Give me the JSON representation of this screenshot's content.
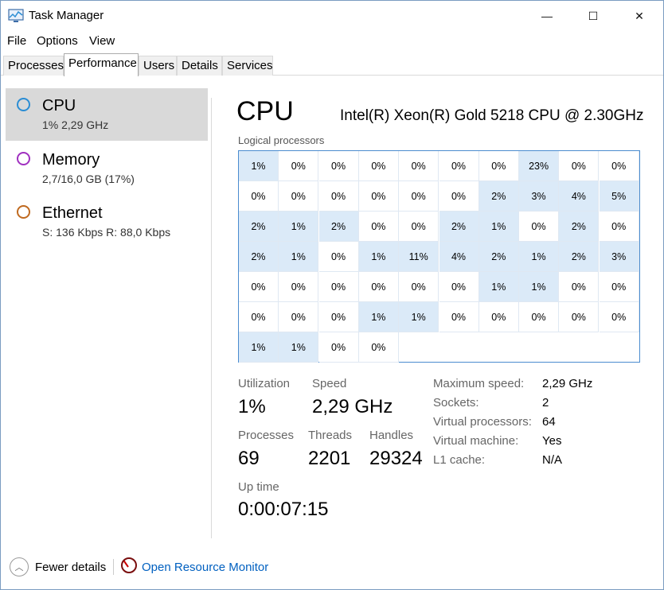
{
  "window": {
    "title": "Task Manager",
    "controls": {
      "minimize": "—",
      "maximize": "☐",
      "close": "✕"
    }
  },
  "menu": [
    "File",
    "Options",
    "View"
  ],
  "tabs": [
    "Processes",
    "Performance",
    "Users",
    "Details",
    "Services"
  ],
  "active_tab": "Performance",
  "sidebar": [
    {
      "name": "CPU",
      "sub": "1% 2,29 GHz",
      "color": "#2a8dd4",
      "selected": true
    },
    {
      "name": "Memory",
      "sub": "2,7/16,0 GB (17%)",
      "color": "#a030c0",
      "selected": false
    },
    {
      "name": "Ethernet",
      "sub": "S: 136 Kbps R: 88,0 Kbps",
      "color": "#c06a20",
      "selected": false
    }
  ],
  "cpu": {
    "title": "CPU",
    "model": "Intel(R) Xeon(R) Gold 5218 CPU @ 2.30GHz",
    "logical_label": "Logical processors",
    "cells": [
      "1%",
      "0%",
      "0%",
      "0%",
      "0%",
      "0%",
      "0%",
      "23%",
      "0%",
      "0%",
      "0%",
      "0%",
      "0%",
      "0%",
      "0%",
      "0%",
      "2%",
      "3%",
      "4%",
      "5%",
      "2%",
      "1%",
      "2%",
      "0%",
      "0%",
      "2%",
      "1%",
      "0%",
      "2%",
      "0%",
      "2%",
      "1%",
      "0%",
      "1%",
      "11%",
      "4%",
      "2%",
      "1%",
      "2%",
      "3%",
      "0%",
      "0%",
      "0%",
      "0%",
      "0%",
      "0%",
      "1%",
      "1%",
      "0%",
      "0%",
      "0%",
      "0%",
      "0%",
      "1%",
      "1%",
      "0%",
      "0%",
      "0%",
      "0%",
      "0%",
      "1%",
      "1%",
      "0%",
      "0%"
    ],
    "highlighted_cells": [
      0,
      7,
      16,
      17,
      18,
      19,
      20,
      21,
      22,
      25,
      26,
      28,
      30,
      31,
      33,
      34,
      35,
      36,
      37,
      38,
      39,
      46,
      47,
      53,
      54,
      60,
      61
    ],
    "stats": {
      "utilization_label": "Utilization",
      "utilization": "1%",
      "speed_label": "Speed",
      "speed": "2,29 GHz",
      "processes_label": "Processes",
      "processes": "69",
      "threads_label": "Threads",
      "threads": "2201",
      "handles_label": "Handles",
      "handles": "29324",
      "uptime_label": "Up time",
      "uptime": "0:00:07:15"
    },
    "info": [
      {
        "label": "Maximum speed:",
        "value": "2,29 GHz"
      },
      {
        "label": "Sockets:",
        "value": "2"
      },
      {
        "label": "Virtual processors:",
        "value": "64"
      },
      {
        "label": "Virtual machine:",
        "value": "Yes"
      },
      {
        "label": "L1 cache:",
        "value": "N/A"
      }
    ]
  },
  "footer": {
    "fewer_details": "Fewer details",
    "open_resource_monitor": "Open Resource Monitor"
  }
}
